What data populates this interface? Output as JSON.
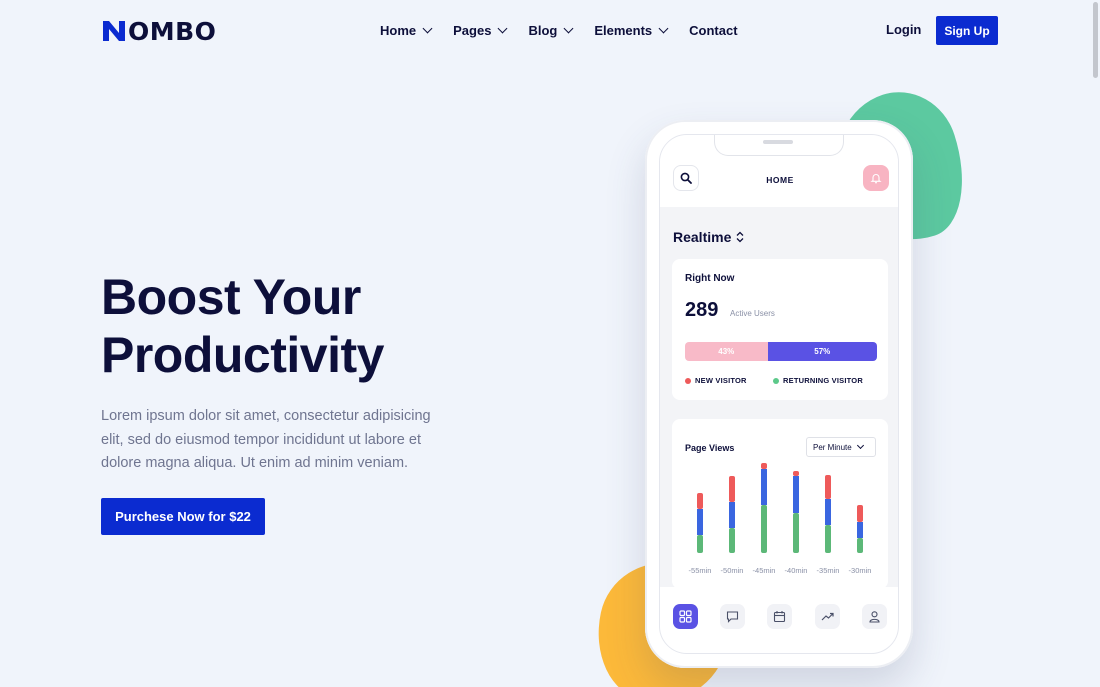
{
  "brand": {
    "name": "OMBO",
    "accent": "#0b2bd0"
  },
  "nav": {
    "items": [
      {
        "label": "Home",
        "has_dropdown": true
      },
      {
        "label": "Pages",
        "has_dropdown": true
      },
      {
        "label": "Blog",
        "has_dropdown": true
      },
      {
        "label": "Elements",
        "has_dropdown": true
      },
      {
        "label": "Contact",
        "has_dropdown": false
      }
    ],
    "login": "Login",
    "signup": "Sign Up"
  },
  "hero": {
    "title_line1": "Boost Your",
    "title_line2": "Productivity",
    "text": "Lorem ipsum dolor sit amet, consectetur adipisicing elit, sed do eiusmod tempor incididunt ut labore et dolore magna aliqua. Ut enim ad minim veniam.",
    "cta": "Purchese Now for $22"
  },
  "phone": {
    "header_title": "HOME",
    "section_title": "Realtime",
    "right_now": {
      "title": "Right Now",
      "count": "289",
      "count_label": "Active Users",
      "new_pct_label": "43%",
      "returning_pct_label": "57%",
      "new_pct": 43,
      "returning_pct": 57,
      "legend_new": "NEW VISITOR",
      "legend_returning": "RETURNING VISITOR",
      "colors": {
        "new": "#ee5a5a",
        "returning": "#5cc98a",
        "bar_new": "#f8bac8",
        "bar_returning": "#5a52e4"
      }
    },
    "page_views": {
      "title": "Page Views",
      "select_value": "Per Minute"
    },
    "tabs": [
      "dashboard-icon",
      "chat-icon",
      "calendar-icon",
      "trend-icon",
      "user-icon"
    ]
  },
  "chart_data": {
    "type": "bar",
    "stacked": true,
    "title": "Page Views",
    "categories": [
      "-55min",
      "-50min",
      "-45min",
      "-40min",
      "-35min",
      "-30min"
    ],
    "series": [
      {
        "values": [
          18,
          25,
          48,
          40,
          28,
          15
        ],
        "color": "#5cb878"
      },
      {
        "values": [
          26,
          26,
          36,
          37,
          26,
          16
        ],
        "color": "#3a66e0"
      },
      {
        "values": [
          16,
          26,
          6,
          5,
          24,
          17
        ],
        "color": "#ee5a5a"
      }
    ],
    "ylim": [
      0,
      70
    ]
  }
}
